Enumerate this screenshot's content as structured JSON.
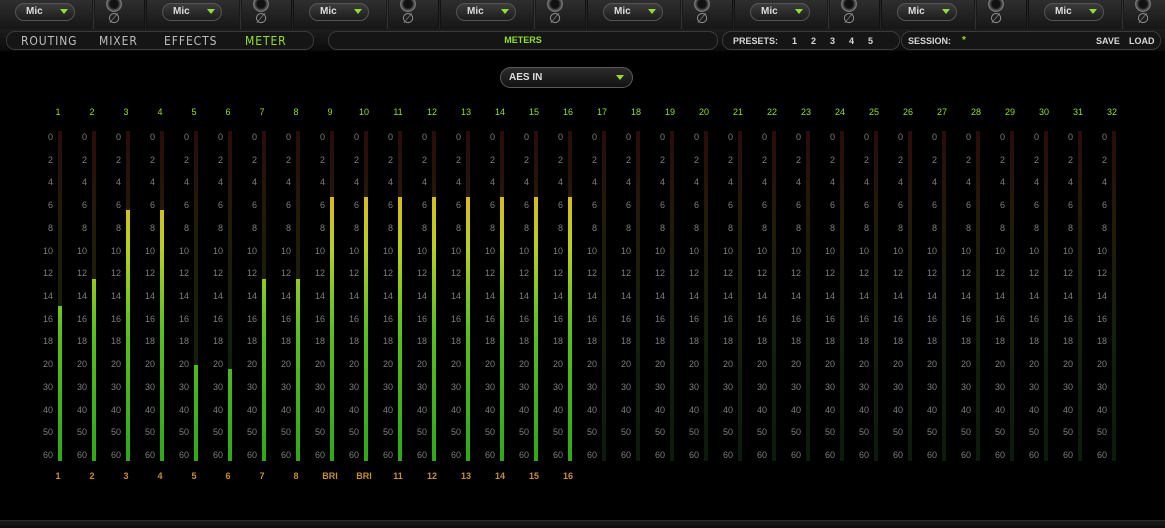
{
  "input_channels": [
    {
      "source": "Mic",
      "phase": "∅"
    },
    {
      "source": "Mic",
      "phase": "∅"
    },
    {
      "source": "Mic",
      "phase": "∅"
    },
    {
      "source": "Mic",
      "phase": "∅"
    },
    {
      "source": "Mic",
      "phase": "∅"
    },
    {
      "source": "Mic",
      "phase": "∅"
    },
    {
      "source": "Mic",
      "phase": "∅"
    },
    {
      "source": "Mic",
      "phase": "∅"
    }
  ],
  "tabs": [
    {
      "label": "ROUTING",
      "active": false
    },
    {
      "label": "MIXER",
      "active": false
    },
    {
      "label": "EFFECTS",
      "active": false
    },
    {
      "label": "METER",
      "active": true
    }
  ],
  "page_title": "METERS",
  "presets": {
    "label": "PRESETS:",
    "numbers": [
      "1",
      "2",
      "3",
      "4",
      "5"
    ]
  },
  "session": {
    "label": "SESSION:",
    "name": "*",
    "save": "SAVE",
    "load": "LOAD"
  },
  "source_select": {
    "value": "AES IN"
  },
  "scale_ticks": [
    "0",
    "2",
    "4",
    "6",
    "8",
    "10",
    "12",
    "14",
    "16",
    "18",
    "20",
    "30",
    "40",
    "50",
    "60"
  ],
  "channel_numbers": [
    "1",
    "2",
    "3",
    "4",
    "5",
    "6",
    "7",
    "8",
    "9",
    "10",
    "11",
    "12",
    "13",
    "14",
    "15",
    "16",
    "17",
    "18",
    "19",
    "20",
    "21",
    "22",
    "23",
    "24",
    "25",
    "26",
    "27",
    "28",
    "29",
    "30",
    "31",
    "32"
  ],
  "meter_levels": [
    0.47,
    0.55,
    0.76,
    0.76,
    0.29,
    0.28,
    0.55,
    0.55,
    0.8,
    0.8,
    0.8,
    0.8,
    0.8,
    0.8,
    0.8,
    0.8,
    0,
    0,
    0,
    0,
    0,
    0,
    0,
    0,
    0,
    0,
    0,
    0,
    0,
    0,
    0,
    0
  ],
  "output_labels": [
    "1",
    "2",
    "3",
    "4",
    "5",
    "6",
    "7",
    "8",
    "BRI",
    "BRI",
    "11",
    "12",
    "13",
    "14",
    "15",
    "16"
  ],
  "colors": {
    "accent": "#8fe02a",
    "output_label": "#c9902a",
    "meter_peak": "#f0a020",
    "meter_low": "#2ea818"
  }
}
